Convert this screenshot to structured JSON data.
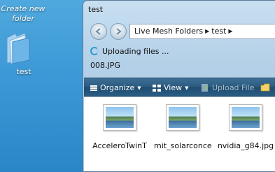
{
  "desktop": {
    "create_label": "Create new folder",
    "folder_label": "test"
  },
  "window": {
    "title": "test",
    "address": {
      "segments": [
        "Live Mesh Folders",
        "test"
      ]
    },
    "status": {
      "uploading_text": "Uploading files ...",
      "current_file": "008.JPG"
    },
    "toolbar": {
      "organize": "Organize",
      "view": "View",
      "upload_file": "Upload File"
    },
    "files": [
      {
        "name": "AcceleroTwinT"
      },
      {
        "name": "mit_solarconce"
      },
      {
        "name": "nvidia_g84.jpg"
      }
    ]
  },
  "colors": {
    "desktop_bg": "#3c98d6",
    "toolbar_bg": "#2b5a7e",
    "accent": "#2e98d8"
  }
}
